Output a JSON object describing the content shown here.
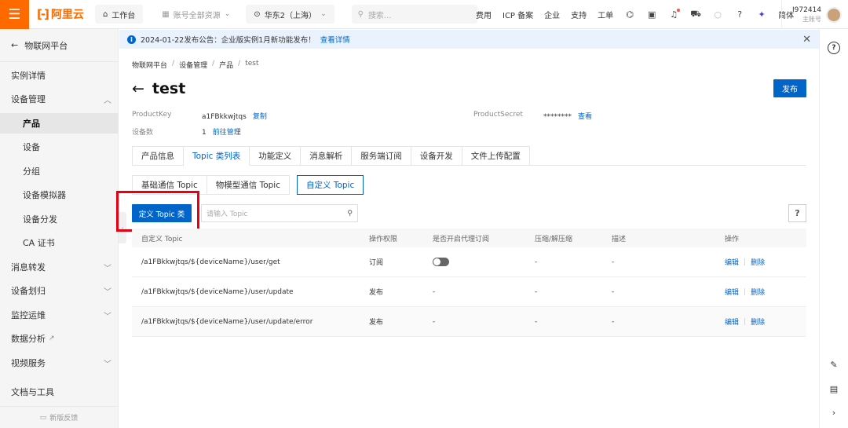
{
  "topbar": {
    "brand": "阿里云",
    "workbench": "工作台",
    "resources": "账号全部资源",
    "region": "华东2（上海）",
    "search_placeholder": "搜索...",
    "links": [
      "费用",
      "ICP 备案",
      "企业",
      "支持",
      "工单"
    ],
    "language": "简体",
    "account_id": "I972414",
    "account_role": "主账号"
  },
  "sidebar": {
    "back_label": "物联网平台",
    "items": [
      {
        "label": "实例详情"
      },
      {
        "label": "设备管理"
      },
      {
        "label": "产品"
      },
      {
        "label": "设备"
      },
      {
        "label": "分组"
      },
      {
        "label": "设备模拟器"
      },
      {
        "label": "设备分发"
      },
      {
        "label": "CA 证书"
      },
      {
        "label": "消息转发"
      },
      {
        "label": "设备划归"
      },
      {
        "label": "监控运维"
      },
      {
        "label": "数据分析"
      },
      {
        "label": "视频服务"
      },
      {
        "label": "文档与工具"
      }
    ],
    "feedback": "新版反馈"
  },
  "notice": {
    "text": "2024-01-22发布公告：企业版实例1月新功能发布！",
    "link": "查看详情"
  },
  "breadcrumb": [
    "物联网平台",
    "设备管理",
    "产品",
    "test"
  ],
  "page": {
    "title": "test",
    "publish_label": "发布"
  },
  "meta": {
    "product_key_label": "ProductKey",
    "product_key_value": "a1FBkkwjtqs",
    "copy_label": "复制",
    "device_count_label": "设备数",
    "device_count_value": "1",
    "manage_label": "前往管理",
    "product_secret_label": "ProductSecret",
    "product_secret_value": "********",
    "view_label": "查看"
  },
  "tabs": [
    "产品信息",
    "Topic 类列表",
    "功能定义",
    "消息解析",
    "服务端订阅",
    "设备开发",
    "文件上传配置"
  ],
  "subtabs": [
    "基础通信 Topic",
    "物模型通信 Topic",
    "自定义 Topic"
  ],
  "toolbar": {
    "define_label": "定义 Topic 类",
    "search_placeholder": "请输入 Topic",
    "help_label": "?"
  },
  "table": {
    "headers": [
      "自定义 Topic",
      "操作权限",
      "是否开启代理订阅",
      "压缩/解压缩",
      "描述",
      "操作"
    ],
    "rows": [
      {
        "topic": "/a1FBkkwjtqs/${deviceName}/user/get",
        "perm": "订阅",
        "proxy": "",
        "compress": "-",
        "desc": "-",
        "edit": "编辑",
        "delete": "删除"
      },
      {
        "topic": "/a1FBkkwjtqs/${deviceName}/user/update",
        "perm": "发布",
        "proxy": "-",
        "compress": "-",
        "desc": "-",
        "edit": "编辑",
        "delete": "删除"
      },
      {
        "topic": "/a1FBkkwjtqs/${deviceName}/user/update/error",
        "perm": "发布",
        "proxy": "-",
        "compress": "-",
        "desc": "-",
        "edit": "编辑",
        "delete": "删除"
      }
    ]
  }
}
